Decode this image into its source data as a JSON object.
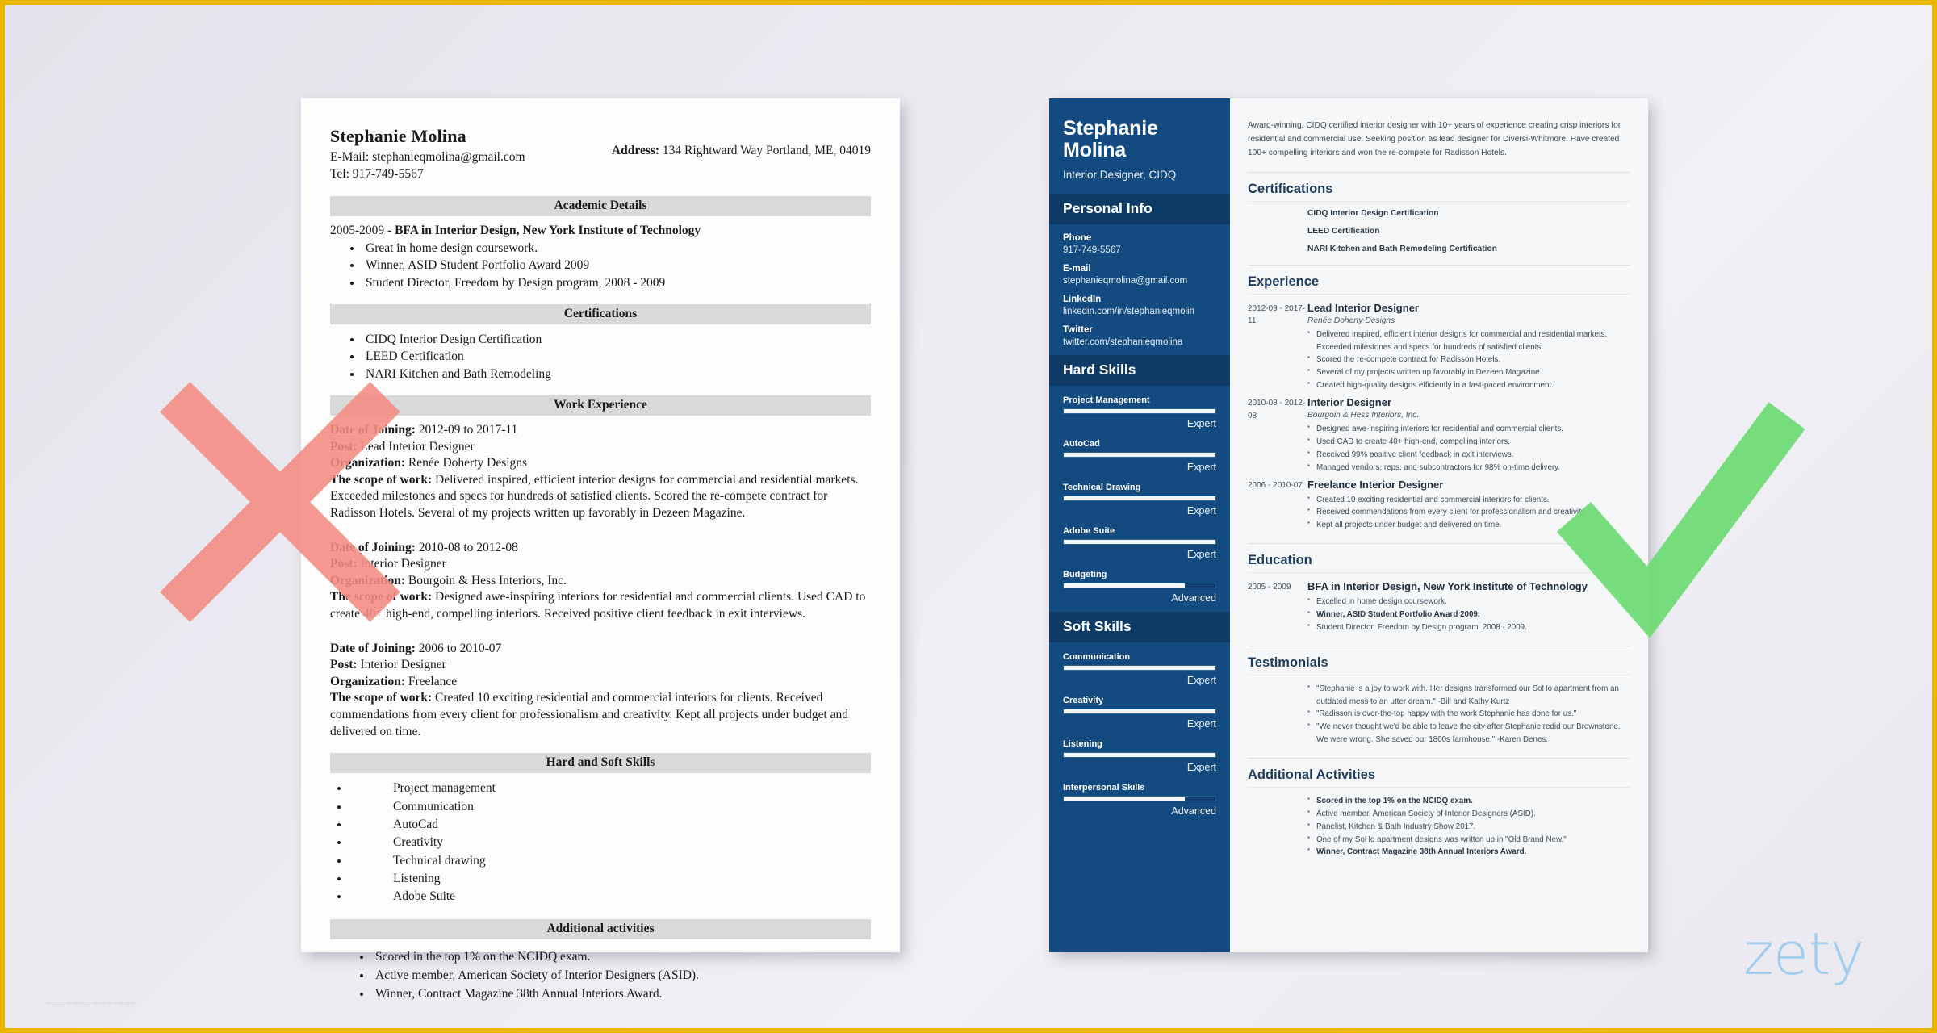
{
  "overlay": {
    "zety_logo": "zety",
    "watermark": "resume-templates-resume-example",
    "x_mark_color": "#f58b84",
    "check_mark_color": "#6ddb72",
    "frame_color": "#e8b600"
  },
  "traditional_resume": {
    "name": "Stephanie Molina",
    "email_line": "E-Mail: stephanieqmolina@gmail.com",
    "tel_line": "Tel: 917-749-5567",
    "address_label": "Address:",
    "address_value": "134 Rightward Way Portland, ME, 04019",
    "sections": {
      "academic": {
        "heading": "Academic Details",
        "degree_years": "2005-2009 - ",
        "degree": "BFA in Interior Design, New York Institute of Technology",
        "bullets": [
          "Great in home design coursework.",
          "Winner, ASID Student Portfolio Award 2009",
          "Student Director, Freedom by Design program, 2008 - 2009"
        ]
      },
      "certifications": {
        "heading": "Certifications",
        "bullets": [
          "CIDQ Interior Design Certification",
          "LEED Certification",
          "NARI Kitchen and Bath Remodeling"
        ]
      },
      "work_experience": {
        "heading": "Work Experience",
        "jobs": [
          {
            "date_label": "Date of Joining:",
            "date_value": " 2012-09 to 2017-11",
            "post_label": "Post:",
            "post_value": " Lead Interior Designer",
            "org_label": "Organization:",
            "org_value": " Renée Doherty Designs",
            "scope_label": "The scope of work:",
            "scope_value": " Delivered inspired, efficient interior designs for commercial and residential markets. Exceeded milestones and specs for hundreds of satisfied clients. Scored the re-compete contract for Radisson Hotels. Several of my projects written up favorably in Dezeen Magazine."
          },
          {
            "date_label": "Date of Joining:",
            "date_value": " 2010-08 to 2012-08",
            "post_label": "Post:",
            "post_value": " Interior Designer",
            "org_label": "Organization:",
            "org_value": " Bourgoin & Hess Interiors, Inc.",
            "scope_label": "The scope of work:",
            "scope_value": " Designed awe-inspiring interiors for residential and commercial clients. Used CAD to create 40+ high-end, compelling interiors. Received positive client feedback in exit interviews."
          },
          {
            "date_label": "Date of Joining:",
            "date_value": " 2006 to 2010-07",
            "post_label": "Post:",
            "post_value": " Interior Designer",
            "org_label": "Organization:",
            "org_value": " Freelance",
            "scope_label": "The scope of work:",
            "scope_value": " Created 10 exciting residential and commercial interiors for clients. Received commendations from every client for professionalism and creativity. Kept all projects under budget and delivered on time."
          }
        ]
      },
      "skills": {
        "heading": "Hard and Soft Skills",
        "items": [
          "Project management",
          "Communication",
          "AutoCad",
          "Creativity",
          "Technical drawing",
          "Listening",
          "Adobe Suite"
        ]
      },
      "additional": {
        "heading": "Additional activities",
        "bullets": [
          "Scored in the top 1% on the NCIDQ exam.",
          "Active member, American Society of Interior Designers (ASID).",
          "Winner, Contract Magazine 38th Annual Interiors Award."
        ]
      }
    }
  },
  "modern_resume": {
    "sidebar": {
      "name": "Stephanie Molina",
      "job_title": "Interior Designer, CIDQ",
      "personal_info_heading": "Personal Info",
      "contacts": [
        {
          "label": "Phone",
          "value": "917-749-5567"
        },
        {
          "label": "E-mail",
          "value": "stephanieqmolina@gmail.com"
        },
        {
          "label": "LinkedIn",
          "value": "linkedin.com/in/stephanieqmolin"
        },
        {
          "label": "Twitter",
          "value": "twitter.com/stephanieqmolina"
        }
      ],
      "hard_skills_heading": "Hard Skills",
      "hard_skills": [
        {
          "name": "Project Management",
          "level": "Expert",
          "percent": 100
        },
        {
          "name": "AutoCad",
          "level": "Expert",
          "percent": 100
        },
        {
          "name": "Technical Drawing",
          "level": "Expert",
          "percent": 100
        },
        {
          "name": "Adobe Suite",
          "level": "Expert",
          "percent": 100
        },
        {
          "name": "Budgeting",
          "level": "Advanced",
          "percent": 80
        }
      ],
      "soft_skills_heading": "Soft Skills",
      "soft_skills": [
        {
          "name": "Communication",
          "level": "Expert",
          "percent": 100
        },
        {
          "name": "Creativity",
          "level": "Expert",
          "percent": 100
        },
        {
          "name": "Listening",
          "level": "Expert",
          "percent": 100
        },
        {
          "name": "Interpersonal Skills",
          "level": "Advanced",
          "percent": 80
        }
      ]
    },
    "main": {
      "summary": "Award-winning, CIDQ certified interior designer with 10+ years of experience creating crisp interiors for residential and commercial use. Seeking position as lead designer for Diversi-Whitmore. Have created 100+ compelling interiors and won the re-compete for Radisson Hotels.",
      "certifications_heading": "Certifications",
      "certifications": [
        "CIDQ Interior Design Certification",
        "LEED Certification",
        "NARI Kitchen and Bath Remodeling Certification"
      ],
      "experience_heading": "Experience",
      "experience": [
        {
          "date": "2012-09 - 2017-11",
          "role": "Lead Interior Designer",
          "org": "Renée Doherty Designs",
          "bullets": [
            "Delivered inspired, efficient interior designs for commercial and residential markets. Exceeded milestones and specs for hundreds of satisfied clients.",
            "Scored the re-compete contract for Radisson Hotels.",
            "Several of my projects written up favorably in Dezeen Magazine.",
            "Created high-quality designs efficiently in a fast-paced environment."
          ]
        },
        {
          "date": "2010-08 - 2012-08",
          "role": "Interior Designer",
          "org": "Bourgoin & Hess Interiors, Inc.",
          "bullets": [
            "Designed awe-inspiring interiors for residential and commercial clients.",
            "Used CAD to create 40+ high-end, compelling interiors.",
            "Received 99% positive client feedback in exit interviews.",
            "Managed vendors, reps, and subcontractors for 98% on-time delivery."
          ]
        },
        {
          "date": "2006 - 2010-07",
          "role": "Freelance Interior Designer",
          "org": "",
          "bullets": [
            "Created 10 exciting residential and commercial interiors for clients.",
            "Received commendations from every client for professionalism and creativity.",
            "Kept all projects under budget and delivered on time."
          ]
        }
      ],
      "education_heading": "Education",
      "education": [
        {
          "date": "2005 - 2009",
          "degree": "BFA in Interior Design, New York Institute of Technology",
          "bullets": [
            {
              "text": "Excelled in home design coursework.",
              "bold": false
            },
            {
              "text": "Winner, ASID Student Portfolio Award 2009.",
              "bold": true
            },
            {
              "text": "Student Director, Freedom by Design program, 2008 - 2009.",
              "bold": false
            }
          ]
        }
      ],
      "testimonials_heading": "Testimonials",
      "testimonials": [
        "\"Stephanie is a joy to work with. Her designs transformed our SoHo apartment from an outdated mess to an utter dream.\" -Bill and Kathy Kurtz",
        "\"Radisson is over-the-top happy with the work Stephanie has done for us.\"",
        "\"We never thought we'd be able to leave the city after Stephanie redid our Brownstone. We were wrong. She saved our 1800s farmhouse.\" -Karen Denes."
      ],
      "additional_heading": "Additional Activities",
      "additional": [
        {
          "text": "Scored in the top 1% on the NCIDQ exam.",
          "bold": true
        },
        {
          "text": "Active member, American Society of Interior Designers (ASID).",
          "bold": false
        },
        {
          "text": "Panelist, Kitchen & Bath Industry Show 2017.",
          "bold": false
        },
        {
          "text": "One of my SoHo apartment designs was written up in \"Old Brand New.\"",
          "bold": false
        },
        {
          "text": "Winner, Contract Magazine 38th Annual Interiors Award.",
          "bold": true
        }
      ]
    }
  }
}
